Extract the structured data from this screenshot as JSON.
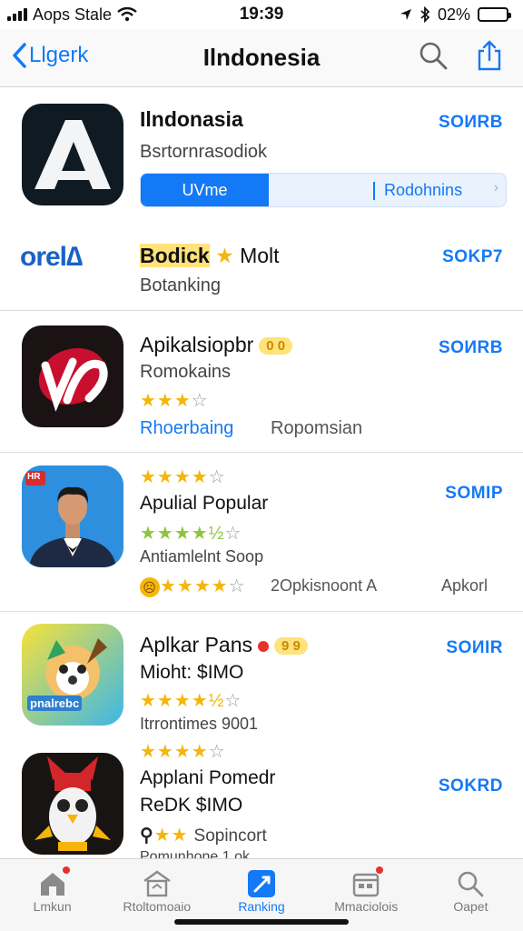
{
  "status": {
    "carrier": "Aops Stale",
    "time": "19:39",
    "battery_pct": "02%",
    "battery_level": 0.92
  },
  "nav": {
    "back": "Llgerk",
    "title": "Ilndonesia"
  },
  "apps": [
    {
      "title": "Ilndonasia",
      "subtitle": "Bsrtornrasodiok",
      "price": "SOИRB",
      "seg_on": "UVme",
      "seg_off": "Rodohnins"
    },
    {
      "icon_text": "orel∆",
      "title_badge": "Bodick",
      "title_rest": "Molt",
      "subtitle": "Botanking",
      "price": "SOKP7"
    },
    {
      "title": "Apikalsiopbr",
      "badge": "0 0",
      "subtitle": "Romokains",
      "stars": "★★★",
      "stars_empty": "☆",
      "link": "Rhoerbaing",
      "extra": "Ropomsian",
      "price": "SOИRB"
    },
    {
      "icon_text": "HR",
      "stars_top": "★★★★",
      "stars_top_empty": "☆",
      "title": "Apulial Popular",
      "stars": "★★★★½",
      "stars_empty": "☆",
      "subtitle": "Antiamlelnt Soop",
      "stars2": "★★★★",
      "stars2_empty": "☆",
      "extra": "2Opkisnoont A",
      "extra2": "Apkorl",
      "price": "SOMIP"
    },
    {
      "icon_text": "pnalrebc",
      "title": "Aplkar Pans",
      "badge": "9 9",
      "subtitle": "Mioht: $IMO",
      "stars": "★★★★½",
      "stars_empty": "☆",
      "meta": "Itrrontimes 9001",
      "price": "SOИIR"
    },
    {
      "stars_top": "★★★★",
      "stars_top_empty": "☆",
      "title": "Applani Pomedr",
      "subtitle": "ReDK $IMO",
      "extra": "Sopincort",
      "meta": "Pomunhone 1 ok",
      "price": "SOKRD"
    }
  ],
  "tabs": [
    {
      "label": "Lmkun",
      "icon": "home-icon"
    },
    {
      "label": "Rtoltomoaio",
      "icon": "store-icon"
    },
    {
      "label": "Ranking",
      "icon": "ranking-icon"
    },
    {
      "label": "Mmaciolois",
      "icon": "calendar-icon"
    },
    {
      "label": "Oapet",
      "icon": "search-icon"
    }
  ],
  "colors": {
    "accent": "#1479f6",
    "star": "#f5b50a",
    "star_green": "#8bc53f",
    "badge_red": "#e8312b"
  }
}
